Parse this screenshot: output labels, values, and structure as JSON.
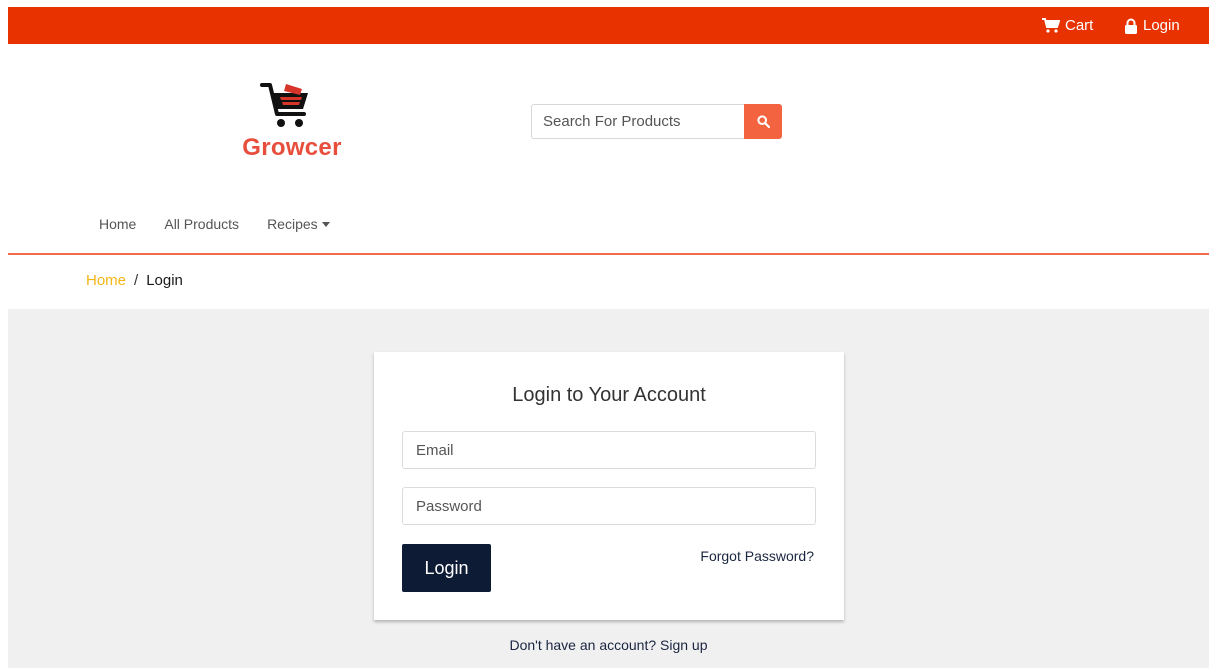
{
  "topbar": {
    "cart_label": "Cart",
    "login_label": "Login",
    "background": "#e83200"
  },
  "brand": {
    "name": "Growcer",
    "color": "#e84e3c",
    "logo_icon": "shopping-cart-icon"
  },
  "search": {
    "placeholder": "Search For Products",
    "button_icon": "search-icon",
    "button_color": "#f4633f"
  },
  "nav": {
    "items": [
      {
        "label": "Home"
      },
      {
        "label": "All Products"
      },
      {
        "label": "Recipes",
        "dropdown": true
      }
    ]
  },
  "breadcrumb": {
    "home": "Home",
    "separator": "/",
    "current": "Login"
  },
  "login_form": {
    "title": "Login to Your Account",
    "email_placeholder": "Email",
    "password_placeholder": "Password",
    "submit_label": "Login",
    "forgot_label": "Forgot Password?",
    "submit_color": "#0e1b35"
  },
  "signup_prompt": "Don't have an account? Sign up"
}
